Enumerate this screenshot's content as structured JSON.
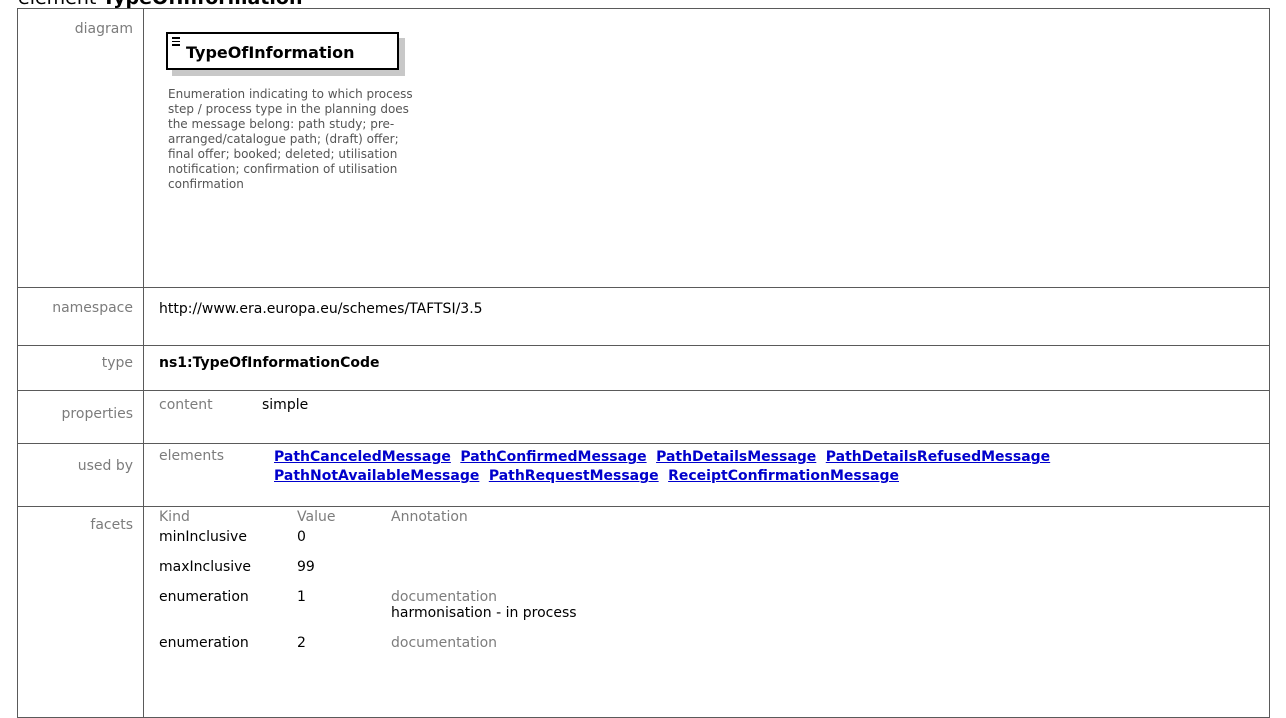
{
  "page": {
    "title_prefix": "element ",
    "title_name": "TypeOfInformation"
  },
  "diagram": {
    "label": "diagram",
    "element_name": "TypeOfInformation",
    "documentation": "Enumeration indicating to which process step / process type in the planning does the message belong: path study; pre-arranged/catalogue path; (draft) offer; final offer; booked; deleted; utilisation notification; confirmation of utilisation confirmation"
  },
  "namespace": {
    "label": "namespace",
    "value": "http://www.era.europa.eu/schemes/TAFTSI/3.5"
  },
  "type": {
    "label": "type",
    "value": "ns1:TypeOfInformationCode"
  },
  "properties": {
    "label": "properties",
    "key": "content",
    "value": "simple"
  },
  "used_by": {
    "label": "used by",
    "key": "elements",
    "links": [
      "PathCanceledMessage",
      "PathConfirmedMessage",
      "PathDetailsMessage",
      "PathDetailsRefusedMessage",
      "PathNotAvailableMessage",
      "PathRequestMessage",
      "ReceiptConfirmationMessage"
    ]
  },
  "facets": {
    "label": "facets",
    "headers": {
      "kind": "Kind",
      "value": "Value",
      "annotation": "Annotation"
    },
    "rows": [
      {
        "kind": "minInclusive",
        "value": "0",
        "doc_label": "",
        "doc_text": ""
      },
      {
        "kind": "maxInclusive",
        "value": "99",
        "doc_label": "",
        "doc_text": ""
      },
      {
        "kind": "enumeration",
        "value": "1",
        "doc_label": "documentation",
        "doc_text": "harmonisation - in process"
      },
      {
        "kind": "enumeration",
        "value": "2",
        "doc_label": "documentation",
        "doc_text": ""
      }
    ]
  }
}
